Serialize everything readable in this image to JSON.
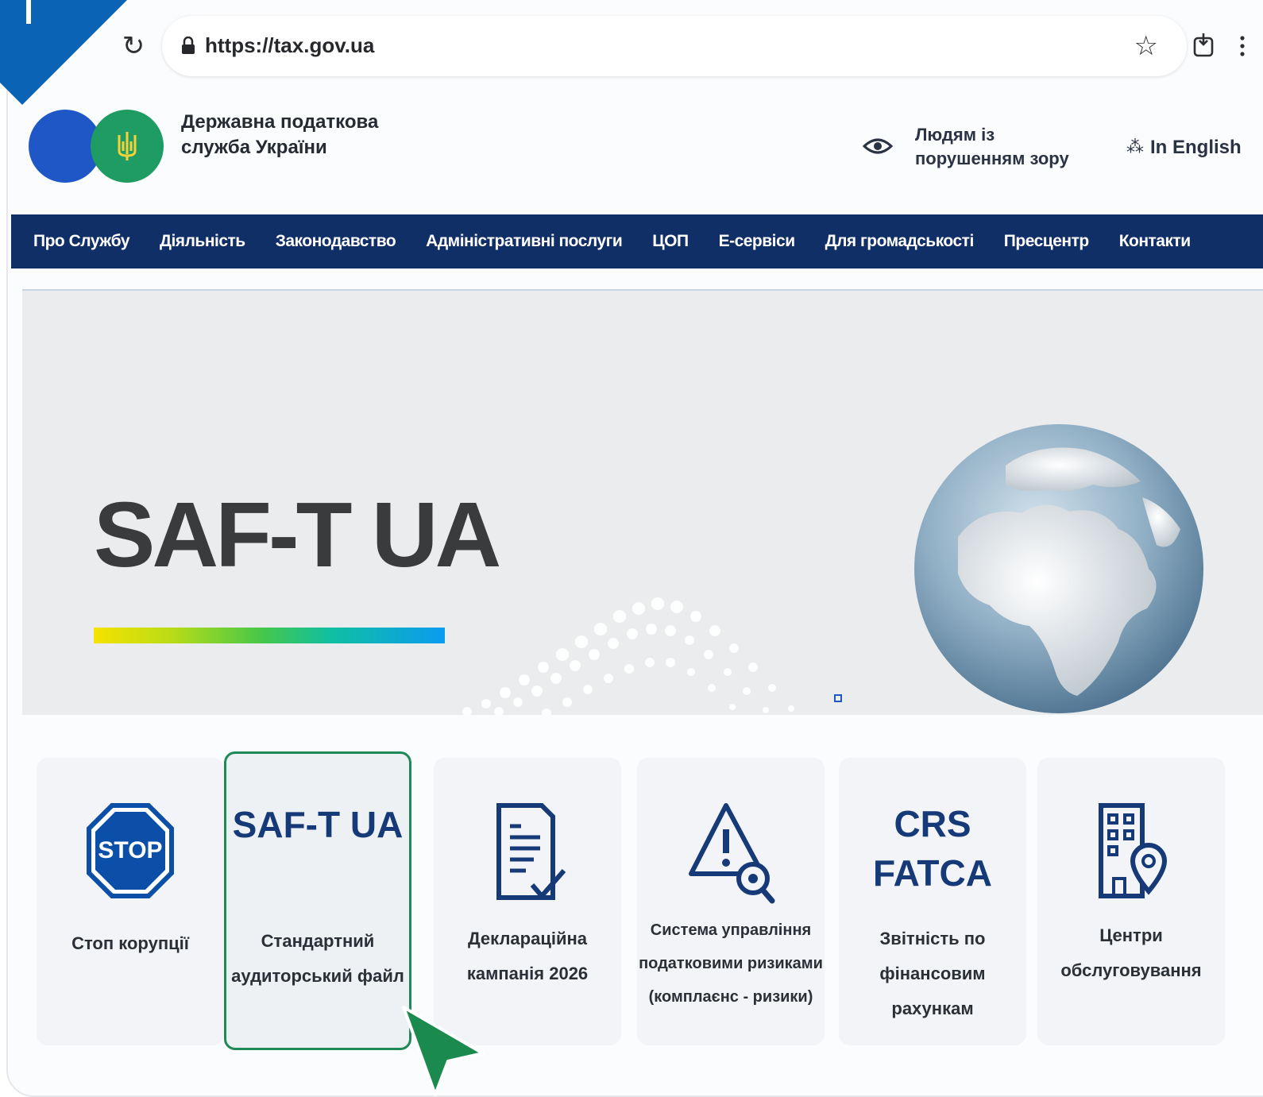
{
  "browser": {
    "url": "https://tax.gov.ua"
  },
  "header": {
    "logo_text": "Державна податкова служба України",
    "accessibility": "Людям із порушенням зору",
    "language": "In English"
  },
  "nav": {
    "items": [
      "Про Службу",
      "Діяльність",
      "Законодавство",
      "Адміністративні послуги",
      "ЦОП",
      "Е-сервіси",
      "Для громадськості",
      "Пресцентр",
      "Контакти"
    ]
  },
  "hero": {
    "title": "SAF-T UA"
  },
  "cards": [
    {
      "icon": "stop-sign-icon",
      "icon_text": "STOP",
      "label": "Стоп корупції"
    },
    {
      "icon": "",
      "big": "SAF-T UA",
      "label": "Стандартний аудиторський файл",
      "active": true
    },
    {
      "icon": "declaration-document-icon",
      "label": "Декларацiйна кампанія 2026"
    },
    {
      "icon": "risk-warning-search-icon",
      "label": "Система управління податковими ризиками (комплаєнс - ризики)"
    },
    {
      "icon": "",
      "big": "CRS FATCA",
      "label": "Звітність по фінансовим рахункам"
    },
    {
      "icon": "building-location-icon",
      "label": "Центри обслуговування"
    }
  ],
  "colors": {
    "nav_bg": "#102f66",
    "brand_blue": "#1f57c7",
    "brand_green": "#1e9c63",
    "card_accent": "#163a78",
    "active_border": "#1f8a57",
    "corner_badge": "#0b63b5"
  }
}
